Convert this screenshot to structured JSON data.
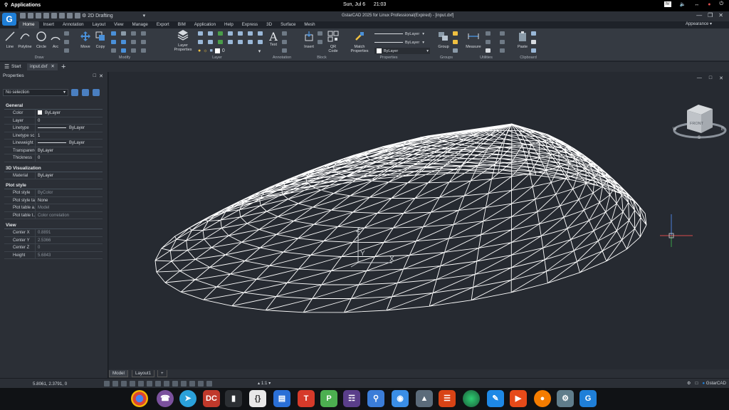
{
  "topbar": {
    "apps_label": "Applications",
    "date": "Sun, Jul 6",
    "time": "21:03",
    "keyboard": "hr"
  },
  "window": {
    "title": "GstarCAD 2025 for Linux Professional(Expired) - [input.dxf]",
    "workspace": "2D Drafting",
    "appearance_label": "Appearance",
    "logo_letter": "G"
  },
  "ribbon_tabs": [
    "Home",
    "Insert",
    "Annotation",
    "Layout",
    "View",
    "Manage",
    "Export",
    "BIM",
    "Application",
    "Help",
    "Express",
    "3D",
    "Surface",
    "Mesh"
  ],
  "ribbon": {
    "draw": {
      "line": "Line",
      "polyline": "Polyline",
      "circle": "Circle",
      "arc": "Arc",
      "group": "Draw"
    },
    "modify": {
      "move": "Move",
      "copy": "Copy",
      "group": "Modify"
    },
    "layer": {
      "properties_line1": "Layer",
      "properties_line2": "Properties",
      "layer_value": "0",
      "group": "Layer"
    },
    "annotation": {
      "text": "Text",
      "group": "Annotation"
    },
    "block": {
      "insert": "Insert",
      "qr_line1": "QR",
      "qr_line2": "Code",
      "group": "Block"
    },
    "properties": {
      "match_line1": "Match",
      "match_line2": "Properties",
      "bylayer1": "ByLayer",
      "bylayer2": "ByLayer",
      "bylayer3": "ByLayer",
      "group": "Properties"
    },
    "groups": {
      "group": "Group",
      "panel": "Groups"
    },
    "utilities": {
      "measure": "Measure",
      "panel": "Utilities"
    },
    "clipboard": {
      "paste": "Paste",
      "panel": "Clipboard"
    }
  },
  "doc_tabs": {
    "start": "Start",
    "file": "input.dxf",
    "add": "+"
  },
  "properties_panel": {
    "title": "Properties",
    "selection": "No selection",
    "sections": [
      {
        "title": "General",
        "rows": [
          {
            "key": "Color",
            "value": "ByLayer",
            "swatch": "#ffffff"
          },
          {
            "key": "Layer",
            "value": "0"
          },
          {
            "key": "Linetype",
            "value": "ByLayer",
            "line": true
          },
          {
            "key": "Linetype sc...",
            "value": "1"
          },
          {
            "key": "Lineweight",
            "value": "ByLayer",
            "line": true
          },
          {
            "key": "Transparency",
            "value": "ByLayer"
          },
          {
            "key": "Thickness",
            "value": "0"
          }
        ]
      },
      {
        "title": "3D Visualization",
        "rows": [
          {
            "key": "Material",
            "value": "ByLayer"
          }
        ]
      },
      {
        "title": "Plot style",
        "rows": [
          {
            "key": "Plot style",
            "value": "ByColor",
            "dim": true
          },
          {
            "key": "Plot style ta...",
            "value": "None"
          },
          {
            "key": "Plot table a...",
            "value": "Model",
            "dim": true
          },
          {
            "key": "Plot table t...",
            "value": "Color correlation",
            "dim": true
          }
        ]
      },
      {
        "title": "View",
        "rows": [
          {
            "key": "Center X",
            "value": "0.8891",
            "dim": true
          },
          {
            "key": "Center Y",
            "value": "2.5366",
            "dim": true
          },
          {
            "key": "Center Z",
            "value": "0",
            "dim": true
          },
          {
            "key": "Height",
            "value": "5.6843",
            "dim": true
          }
        ]
      }
    ]
  },
  "viewcube": {
    "face": "FRONT",
    "west": "W",
    "south": "S",
    "east": "E"
  },
  "ucs": {
    "x": "X",
    "y": "Y",
    "z": "Z"
  },
  "layout_tabs": [
    "Model",
    "Layout1",
    "+"
  ],
  "status": {
    "coords": "5.8061, 2.3791, 0",
    "scale": "1:1",
    "app_name": "GstarCAD"
  },
  "colors": {
    "accent": "#1f7fd8",
    "background": "#262a31",
    "wire": "#ffffff"
  }
}
